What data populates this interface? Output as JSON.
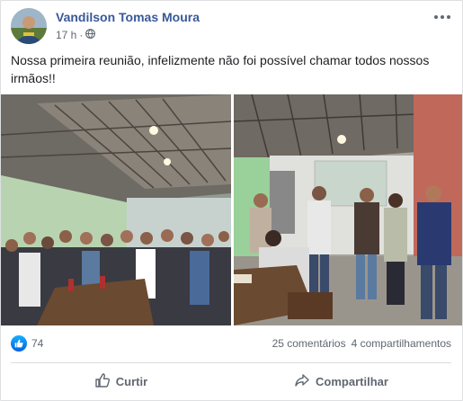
{
  "post": {
    "author": "Vandilson Tomas Moura",
    "time": "17 h",
    "separator": "·",
    "text": "Nossa primeira reunião, infelizmente não foi possível chamar todos nossos irmãos!!"
  },
  "stats": {
    "likes": "74",
    "comments": "25 comentários",
    "shares": "4 compartilhamentos"
  },
  "actions": {
    "like": "Curtir",
    "share": "Compartilhar"
  },
  "icons": {
    "menu": "more-options-icon",
    "privacy": "globe-icon",
    "reaction": "like-icon",
    "like_action": "thumb-up-outline-icon",
    "share_action": "share-arrow-icon"
  },
  "colors": {
    "author_link": "#385898",
    "like_blue": "#1877f2",
    "text": "#1c1e21",
    "secondary_text": "#606770"
  }
}
